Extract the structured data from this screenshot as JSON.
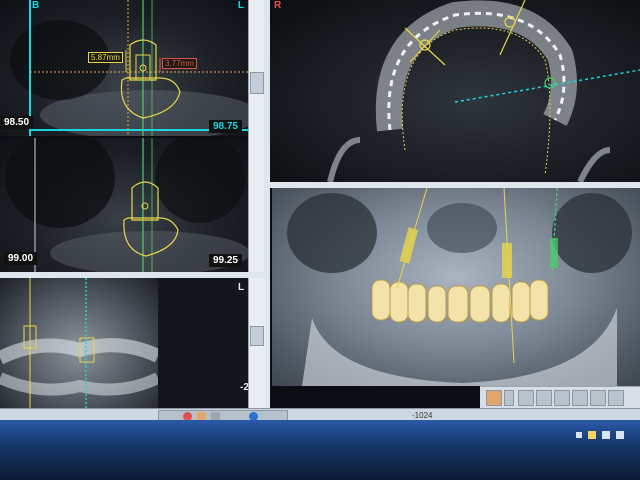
{
  "views": {
    "cross_section_top": {
      "left_value": "98.50",
      "right_value": "98.75",
      "corner_label": "L",
      "top_label": "B",
      "measure_left": "5.87mm",
      "measure_right": "3.77mm"
    },
    "cross_section_bottom": {
      "left_value": "99.00",
      "right_value": "99.25"
    },
    "axial": {
      "corner_label": "R"
    },
    "panoramic": {
      "corner_label": "L",
      "side_value": "-2"
    },
    "render_3d": {}
  },
  "status_bar": {
    "center_value": "-1024"
  },
  "colors": {
    "accent_cyan": "#18d6e0",
    "implant_yellow": "#e7d64a",
    "guide_green": "#47d36a",
    "measure_red": "#e05050",
    "axis_orange": "#f0a24a"
  }
}
